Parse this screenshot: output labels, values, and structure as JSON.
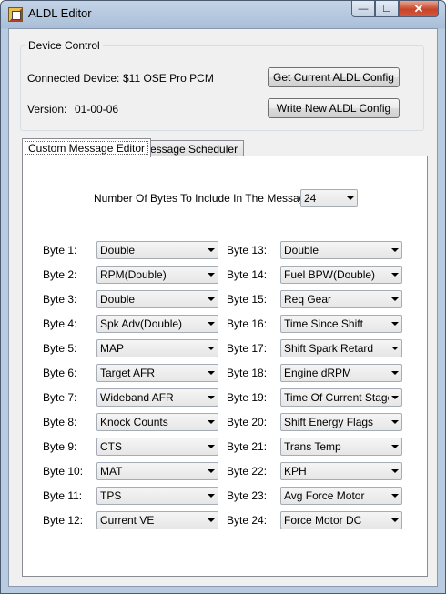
{
  "window": {
    "title": "ALDL Editor",
    "minimize_glyph": "—",
    "maximize_glyph": "☐",
    "close_glyph": "✕"
  },
  "device_control": {
    "title": "Device Control",
    "connected_label": "Connected Device:",
    "connected_value": "$11 OSE Pro  PCM",
    "version_label": "Version:",
    "version_value": "01-00-06",
    "get_config_label": "Get Current ALDL Config",
    "write_config_label": "Write New ALDL Config"
  },
  "tabs": [
    {
      "label": "Custom Message Editor",
      "active": true
    },
    {
      "label": "Message Scheduler",
      "active": false
    }
  ],
  "editor": {
    "num_bytes_label": "Number Of Bytes To Include In The Message:",
    "num_bytes_value": "24",
    "left_bytes": [
      {
        "label": "Byte 1:",
        "value": "Double"
      },
      {
        "label": "Byte 2:",
        "value": "RPM(Double)"
      },
      {
        "label": "Byte 3:",
        "value": "Double"
      },
      {
        "label": "Byte 4:",
        "value": "Spk Adv(Double)"
      },
      {
        "label": "Byte 5:",
        "value": "MAP"
      },
      {
        "label": "Byte 6:",
        "value": "Target AFR"
      },
      {
        "label": "Byte 7:",
        "value": "Wideband AFR"
      },
      {
        "label": "Byte 8:",
        "value": "Knock Counts"
      },
      {
        "label": "Byte 9:",
        "value": "CTS"
      },
      {
        "label": "Byte 10:",
        "value": "MAT"
      },
      {
        "label": "Byte 11:",
        "value": "TPS"
      },
      {
        "label": "Byte 12:",
        "value": "Current VE"
      }
    ],
    "right_bytes": [
      {
        "label": "Byte 13:",
        "value": "Double"
      },
      {
        "label": "Byte 14:",
        "value": "Fuel BPW(Double)"
      },
      {
        "label": "Byte 15:",
        "value": "Req Gear"
      },
      {
        "label": "Byte 16:",
        "value": "Time Since Shift"
      },
      {
        "label": "Byte 17:",
        "value": "Shift Spark Retard"
      },
      {
        "label": "Byte 18:",
        "value": "Engine dRPM"
      },
      {
        "label": "Byte 19:",
        "value": "Time Of Current Stage"
      },
      {
        "label": "Byte 20:",
        "value": "Shift Energy Flags"
      },
      {
        "label": "Byte 21:",
        "value": "Trans Temp"
      },
      {
        "label": "Byte 22:",
        "value": "KPH"
      },
      {
        "label": "Byte 23:",
        "value": "Avg Force Motor"
      },
      {
        "label": "Byte 24:",
        "value": "Force Motor DC"
      }
    ]
  }
}
